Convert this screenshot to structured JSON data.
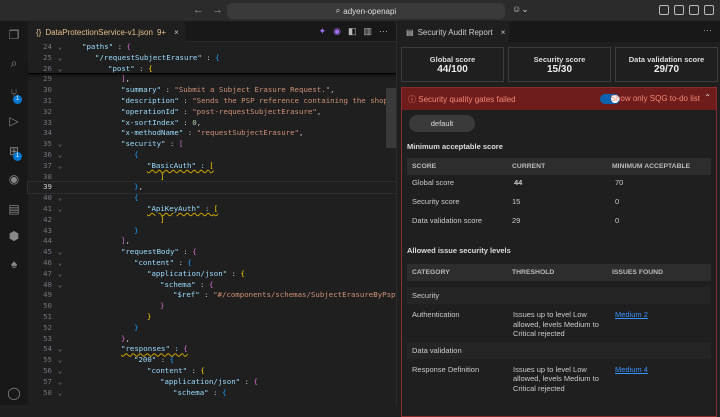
{
  "titlebar": {
    "search_text": "adyen-openapi",
    "back": "←",
    "forward": "→"
  },
  "activity": {
    "scm_badge": "1",
    "ext_badge": "1"
  },
  "editor": {
    "tab_icon": "{}",
    "tab_label": "DataProtectionService-v1.json",
    "tab_badge": "9+",
    "close": "×"
  },
  "code": [
    {
      "num": "24",
      "fold": true,
      "ind": 1,
      "seg": [
        [
          "k",
          "\"paths\""
        ],
        [
          "p",
          " : "
        ],
        [
          "b2",
          "{"
        ]
      ]
    },
    {
      "num": "25",
      "fold": true,
      "ind": 2,
      "seg": [
        [
          "k",
          "\"/requestSubjectErasure\""
        ],
        [
          "p",
          " : "
        ],
        [
          "b3",
          "{"
        ]
      ]
    },
    {
      "num": "26",
      "fold": true,
      "ind": 3,
      "seg": [
        [
          "k",
          "\"post\""
        ],
        [
          "p",
          " : "
        ],
        [
          "b1",
          "{"
        ]
      ]
    },
    {
      "num": "29",
      "ind": 4,
      "seg": [
        [
          "b2",
          "]"
        ],
        [
          "p",
          ","
        ]
      ]
    },
    {
      "num": "30",
      "ind": 4,
      "seg": [
        [
          "k",
          "\"summary\""
        ],
        [
          "p",
          " : "
        ],
        [
          "s",
          "\"Submit a Subject Erasure Request.\""
        ],
        [
          "p",
          ","
        ]
      ]
    },
    {
      "num": "31",
      "ind": 4,
      "seg": [
        [
          "k",
          "\"description\""
        ],
        [
          "p",
          " : "
        ],
        [
          "s",
          "\"Sends the PSP reference containing the shopper"
        ]
      ]
    },
    {
      "num": "32",
      "ind": 4,
      "seg": [
        [
          "k",
          "\"operationId\""
        ],
        [
          "p",
          " : "
        ],
        [
          "s",
          "\"post-requestSubjectErasure\""
        ],
        [
          "p",
          ","
        ]
      ]
    },
    {
      "num": "33",
      "ind": 4,
      "seg": [
        [
          "k",
          "\"x-sortIndex\""
        ],
        [
          "p",
          " : "
        ],
        [
          "n",
          "0"
        ],
        [
          "p",
          ","
        ]
      ]
    },
    {
      "num": "34",
      "ind": 4,
      "seg": [
        [
          "k",
          "\"x-methodName\""
        ],
        [
          "p",
          " : "
        ],
        [
          "s",
          "\"requestSubjectErasure\""
        ],
        [
          "p",
          ","
        ]
      ]
    },
    {
      "num": "35",
      "fold": true,
      "ind": 4,
      "seg": [
        [
          "k",
          "\"security\""
        ],
        [
          "p",
          " : "
        ],
        [
          "b2",
          "["
        ]
      ]
    },
    {
      "num": "36",
      "fold": true,
      "ind": 5,
      "seg": [
        [
          "b3",
          "{"
        ]
      ]
    },
    {
      "num": "37",
      "fold": true,
      "ind": 6,
      "seg": [
        [
          "k wavy",
          "\"BasicAuth\" : "
        ],
        [
          "b1 wavy",
          "["
        ]
      ]
    },
    {
      "num": "38",
      "ind": 7,
      "seg": [
        [
          "b1",
          "]"
        ]
      ]
    },
    {
      "num": "39",
      "ind": 5,
      "cur": true,
      "seg": [
        [
          "b3",
          "}"
        ],
        [
          "p",
          ","
        ]
      ]
    },
    {
      "num": "40",
      "fold": true,
      "ind": 5,
      "seg": [
        [
          "b3",
          "{"
        ]
      ]
    },
    {
      "num": "41",
      "fold": true,
      "ind": 6,
      "seg": [
        [
          "k wavy",
          "\"ApiKeyAuth\" : "
        ],
        [
          "b1 wavy",
          "["
        ]
      ]
    },
    {
      "num": "42",
      "ind": 7,
      "seg": [
        [
          "b1",
          "]"
        ]
      ]
    },
    {
      "num": "43",
      "ind": 5,
      "seg": [
        [
          "b3",
          "}"
        ]
      ]
    },
    {
      "num": "44",
      "ind": 4,
      "seg": [
        [
          "b2",
          "]"
        ],
        [
          "p",
          ","
        ]
      ]
    },
    {
      "num": "45",
      "fold": true,
      "ind": 4,
      "seg": [
        [
          "k",
          "\"requestBody\""
        ],
        [
          "p",
          " : "
        ],
        [
          "b2",
          "{"
        ]
      ]
    },
    {
      "num": "46",
      "fold": true,
      "ind": 5,
      "seg": [
        [
          "k",
          "\"content\""
        ],
        [
          "p",
          " : "
        ],
        [
          "b3",
          "{"
        ]
      ]
    },
    {
      "num": "47",
      "fold": true,
      "ind": 6,
      "seg": [
        [
          "k",
          "\"application/json\""
        ],
        [
          "p",
          " : "
        ],
        [
          "b1",
          "{"
        ]
      ]
    },
    {
      "num": "48",
      "fold": true,
      "ind": 7,
      "seg": [
        [
          "k",
          "\"schema\""
        ],
        [
          "p",
          " : "
        ],
        [
          "b2",
          "{"
        ]
      ]
    },
    {
      "num": "49",
      "ind": 8,
      "seg": [
        [
          "k",
          "\"$ref\""
        ],
        [
          "p",
          " : "
        ],
        [
          "s",
          "\"#/components/schemas/SubjectErasureByPspRe"
        ]
      ]
    },
    {
      "num": "50",
      "ind": 7,
      "seg": [
        [
          "b2",
          "}"
        ]
      ]
    },
    {
      "num": "51",
      "ind": 6,
      "seg": [
        [
          "b1",
          "}"
        ]
      ]
    },
    {
      "num": "52",
      "ind": 5,
      "seg": [
        [
          "b3",
          "}"
        ]
      ]
    },
    {
      "num": "53",
      "ind": 4,
      "seg": [
        [
          "b2",
          "}"
        ],
        [
          "p",
          ","
        ]
      ]
    },
    {
      "num": "54",
      "fold": true,
      "ind": 4,
      "seg": [
        [
          "k wavy",
          "\"responses\" : "
        ],
        [
          "b2 wavy",
          "{"
        ]
      ]
    },
    {
      "num": "55",
      "fold": true,
      "ind": 5,
      "seg": [
        [
          "k",
          "\"200\""
        ],
        [
          "p",
          " : "
        ],
        [
          "b3",
          "{"
        ]
      ]
    },
    {
      "num": "56",
      "fold": true,
      "ind": 6,
      "seg": [
        [
          "k",
          "\"content\""
        ],
        [
          "p",
          " : "
        ],
        [
          "b1",
          "{"
        ]
      ]
    },
    {
      "num": "57",
      "fold": true,
      "ind": 7,
      "seg": [
        [
          "k",
          "\"application/json\""
        ],
        [
          "p",
          " : "
        ],
        [
          "b2",
          "{"
        ]
      ]
    },
    {
      "num": "58",
      "fold": true,
      "ind": 8,
      "seg": [
        [
          "k",
          "\"schema\""
        ],
        [
          "p",
          " : "
        ],
        [
          "b3",
          "{"
        ]
      ]
    }
  ],
  "panel": {
    "tab_label": "Security Audit Report",
    "close": "×",
    "more": "···",
    "cards": [
      {
        "label": "Global score",
        "value": "44/100"
      },
      {
        "label": "Security score",
        "value": "15/30"
      },
      {
        "label": "Data validation score",
        "value": "29/70"
      }
    ],
    "gate_message": "Security quality gates failed",
    "toggle_label": "Show only SQG to-do list",
    "toggle_on": true,
    "pill": "default",
    "min_heading": "Minimum acceptable score",
    "score_headers": [
      "SCORE",
      "CURRENT",
      "MINIMUM ACCEPTABLE"
    ],
    "scores": [
      [
        "Global score",
        "44",
        "70"
      ],
      [
        "Security score",
        "15",
        "0"
      ],
      [
        "Data validation score",
        "29",
        "0"
      ]
    ],
    "issues_heading": "Allowed issue security levels",
    "issue_headers": [
      "CATEGORY",
      "THRESHOLD",
      "ISSUES FOUND"
    ],
    "issues": [
      {
        "category": "Security",
        "name": "Authentication",
        "threshold": "Issues up to level Low allowed, levels Medium to Critical rejected",
        "found": "Medium 2"
      },
      {
        "category": "Data validation",
        "name": "Response Definition",
        "threshold": "Issues up to level Low allowed, levels Medium to Critical rejected",
        "found": "Medium 4"
      }
    ]
  }
}
